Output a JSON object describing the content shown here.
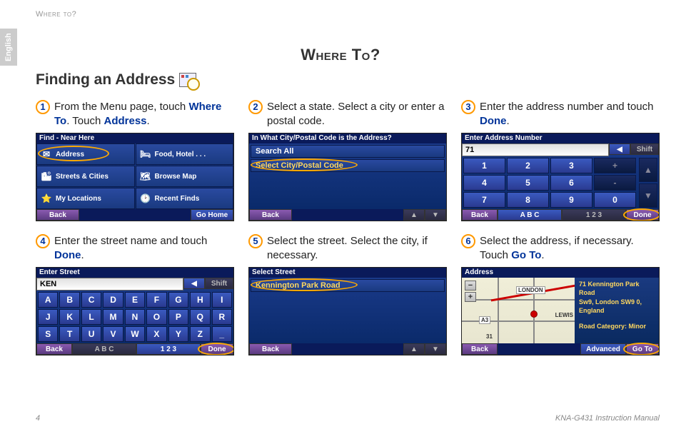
{
  "page_header": "Where to?",
  "lang_tab": "English",
  "title": "Where To?",
  "subtitle": "Finding an Address",
  "steps": [
    {
      "num": "1",
      "text_pre": "From the Menu page, touch ",
      "b1": "Where To",
      "mid": ". Touch ",
      "b2": "Address",
      "post": "."
    },
    {
      "num": "2",
      "text": "Select a state. Select a city or enter a postal code."
    },
    {
      "num": "3",
      "text_pre": "Enter the address number and touch ",
      "b1": "Done",
      "post": "."
    },
    {
      "num": "4",
      "text_pre": "Enter the street name and touch ",
      "b1": "Done",
      "post": "."
    },
    {
      "num": "5",
      "text": "Select the street. Select the city, if necessary."
    },
    {
      "num": "6",
      "text_pre": "Select the address, if necessary. Touch ",
      "b1": "Go To",
      "post": "."
    }
  ],
  "shot1": {
    "title": "Find - Near Here",
    "items": [
      "Address",
      "Food, Hotel . . .",
      "Streets & Cities",
      "Browse Map",
      "My Locations",
      "Recent Finds"
    ],
    "back": "Back",
    "home": "Go Home"
  },
  "shot2": {
    "title": "In What City/Postal Code is the Address?",
    "row1": "Search All",
    "row2": "Select City/Postal Code",
    "back": "Back"
  },
  "shot3": {
    "title": "Enter Address Number",
    "input": "71",
    "shift": "Shift",
    "keys": [
      "1",
      "2",
      "3",
      "+",
      "4",
      "5",
      "6",
      "-",
      "7",
      "8",
      "9",
      "0"
    ],
    "back": "Back",
    "abc": "A B C",
    "num": "1 2 3",
    "done": "Done"
  },
  "shot4": {
    "title": "Enter Street",
    "input": "KEN",
    "shift": "Shift",
    "keys": [
      "A",
      "B",
      "C",
      "D",
      "E",
      "F",
      "G",
      "H",
      "I",
      "J",
      "K",
      "L",
      "M",
      "N",
      "O",
      "P",
      "Q",
      "R",
      "S",
      "T",
      "U",
      "V",
      "W",
      "X",
      "Y",
      "Z",
      "_"
    ],
    "back": "Back",
    "abc": "A B C",
    "num": "1 2 3",
    "done": "Done"
  },
  "shot5": {
    "title": "Select Street",
    "row1": "Kennington Park Road",
    "back": "Back"
  },
  "shot6": {
    "title": "Address",
    "london": "LONDON",
    "a3": "A3",
    "r31": "31",
    "lewis": "LEWIS",
    "addr1": "71 Kennington Park Road",
    "addr2": "Sw9, London SW9 0, England",
    "cat": "Road Category: Minor",
    "back": "Back",
    "adv": "Advanced",
    "goto": "Go To"
  },
  "footer": {
    "page": "4",
    "manual": "KNA-G431 Instruction Manual"
  }
}
